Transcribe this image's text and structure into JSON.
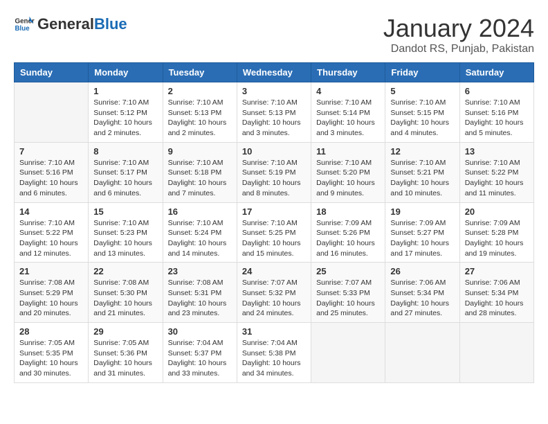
{
  "header": {
    "logo_general": "General",
    "logo_blue": "Blue",
    "month_year": "January 2024",
    "location": "Dandot RS, Punjab, Pakistan"
  },
  "weekdays": [
    "Sunday",
    "Monday",
    "Tuesday",
    "Wednesday",
    "Thursday",
    "Friday",
    "Saturday"
  ],
  "weeks": [
    [
      {
        "day": "",
        "info": ""
      },
      {
        "day": "1",
        "info": "Sunrise: 7:10 AM\nSunset: 5:12 PM\nDaylight: 10 hours\nand 2 minutes."
      },
      {
        "day": "2",
        "info": "Sunrise: 7:10 AM\nSunset: 5:13 PM\nDaylight: 10 hours\nand 2 minutes."
      },
      {
        "day": "3",
        "info": "Sunrise: 7:10 AM\nSunset: 5:13 PM\nDaylight: 10 hours\nand 3 minutes."
      },
      {
        "day": "4",
        "info": "Sunrise: 7:10 AM\nSunset: 5:14 PM\nDaylight: 10 hours\nand 3 minutes."
      },
      {
        "day": "5",
        "info": "Sunrise: 7:10 AM\nSunset: 5:15 PM\nDaylight: 10 hours\nand 4 minutes."
      },
      {
        "day": "6",
        "info": "Sunrise: 7:10 AM\nSunset: 5:16 PM\nDaylight: 10 hours\nand 5 minutes."
      }
    ],
    [
      {
        "day": "7",
        "info": "Sunrise: 7:10 AM\nSunset: 5:16 PM\nDaylight: 10 hours\nand 6 minutes."
      },
      {
        "day": "8",
        "info": "Sunrise: 7:10 AM\nSunset: 5:17 PM\nDaylight: 10 hours\nand 6 minutes."
      },
      {
        "day": "9",
        "info": "Sunrise: 7:10 AM\nSunset: 5:18 PM\nDaylight: 10 hours\nand 7 minutes."
      },
      {
        "day": "10",
        "info": "Sunrise: 7:10 AM\nSunset: 5:19 PM\nDaylight: 10 hours\nand 8 minutes."
      },
      {
        "day": "11",
        "info": "Sunrise: 7:10 AM\nSunset: 5:20 PM\nDaylight: 10 hours\nand 9 minutes."
      },
      {
        "day": "12",
        "info": "Sunrise: 7:10 AM\nSunset: 5:21 PM\nDaylight: 10 hours\nand 10 minutes."
      },
      {
        "day": "13",
        "info": "Sunrise: 7:10 AM\nSunset: 5:22 PM\nDaylight: 10 hours\nand 11 minutes."
      }
    ],
    [
      {
        "day": "14",
        "info": "Sunrise: 7:10 AM\nSunset: 5:22 PM\nDaylight: 10 hours\nand 12 minutes."
      },
      {
        "day": "15",
        "info": "Sunrise: 7:10 AM\nSunset: 5:23 PM\nDaylight: 10 hours\nand 13 minutes."
      },
      {
        "day": "16",
        "info": "Sunrise: 7:10 AM\nSunset: 5:24 PM\nDaylight: 10 hours\nand 14 minutes."
      },
      {
        "day": "17",
        "info": "Sunrise: 7:10 AM\nSunset: 5:25 PM\nDaylight: 10 hours\nand 15 minutes."
      },
      {
        "day": "18",
        "info": "Sunrise: 7:09 AM\nSunset: 5:26 PM\nDaylight: 10 hours\nand 16 minutes."
      },
      {
        "day": "19",
        "info": "Sunrise: 7:09 AM\nSunset: 5:27 PM\nDaylight: 10 hours\nand 17 minutes."
      },
      {
        "day": "20",
        "info": "Sunrise: 7:09 AM\nSunset: 5:28 PM\nDaylight: 10 hours\nand 19 minutes."
      }
    ],
    [
      {
        "day": "21",
        "info": "Sunrise: 7:08 AM\nSunset: 5:29 PM\nDaylight: 10 hours\nand 20 minutes."
      },
      {
        "day": "22",
        "info": "Sunrise: 7:08 AM\nSunset: 5:30 PM\nDaylight: 10 hours\nand 21 minutes."
      },
      {
        "day": "23",
        "info": "Sunrise: 7:08 AM\nSunset: 5:31 PM\nDaylight: 10 hours\nand 23 minutes."
      },
      {
        "day": "24",
        "info": "Sunrise: 7:07 AM\nSunset: 5:32 PM\nDaylight: 10 hours\nand 24 minutes."
      },
      {
        "day": "25",
        "info": "Sunrise: 7:07 AM\nSunset: 5:33 PM\nDaylight: 10 hours\nand 25 minutes."
      },
      {
        "day": "26",
        "info": "Sunrise: 7:06 AM\nSunset: 5:34 PM\nDaylight: 10 hours\nand 27 minutes."
      },
      {
        "day": "27",
        "info": "Sunrise: 7:06 AM\nSunset: 5:34 PM\nDaylight: 10 hours\nand 28 minutes."
      }
    ],
    [
      {
        "day": "28",
        "info": "Sunrise: 7:05 AM\nSunset: 5:35 PM\nDaylight: 10 hours\nand 30 minutes."
      },
      {
        "day": "29",
        "info": "Sunrise: 7:05 AM\nSunset: 5:36 PM\nDaylight: 10 hours\nand 31 minutes."
      },
      {
        "day": "30",
        "info": "Sunrise: 7:04 AM\nSunset: 5:37 PM\nDaylight: 10 hours\nand 33 minutes."
      },
      {
        "day": "31",
        "info": "Sunrise: 7:04 AM\nSunset: 5:38 PM\nDaylight: 10 hours\nand 34 minutes."
      },
      {
        "day": "",
        "info": ""
      },
      {
        "day": "",
        "info": ""
      },
      {
        "day": "",
        "info": ""
      }
    ]
  ]
}
